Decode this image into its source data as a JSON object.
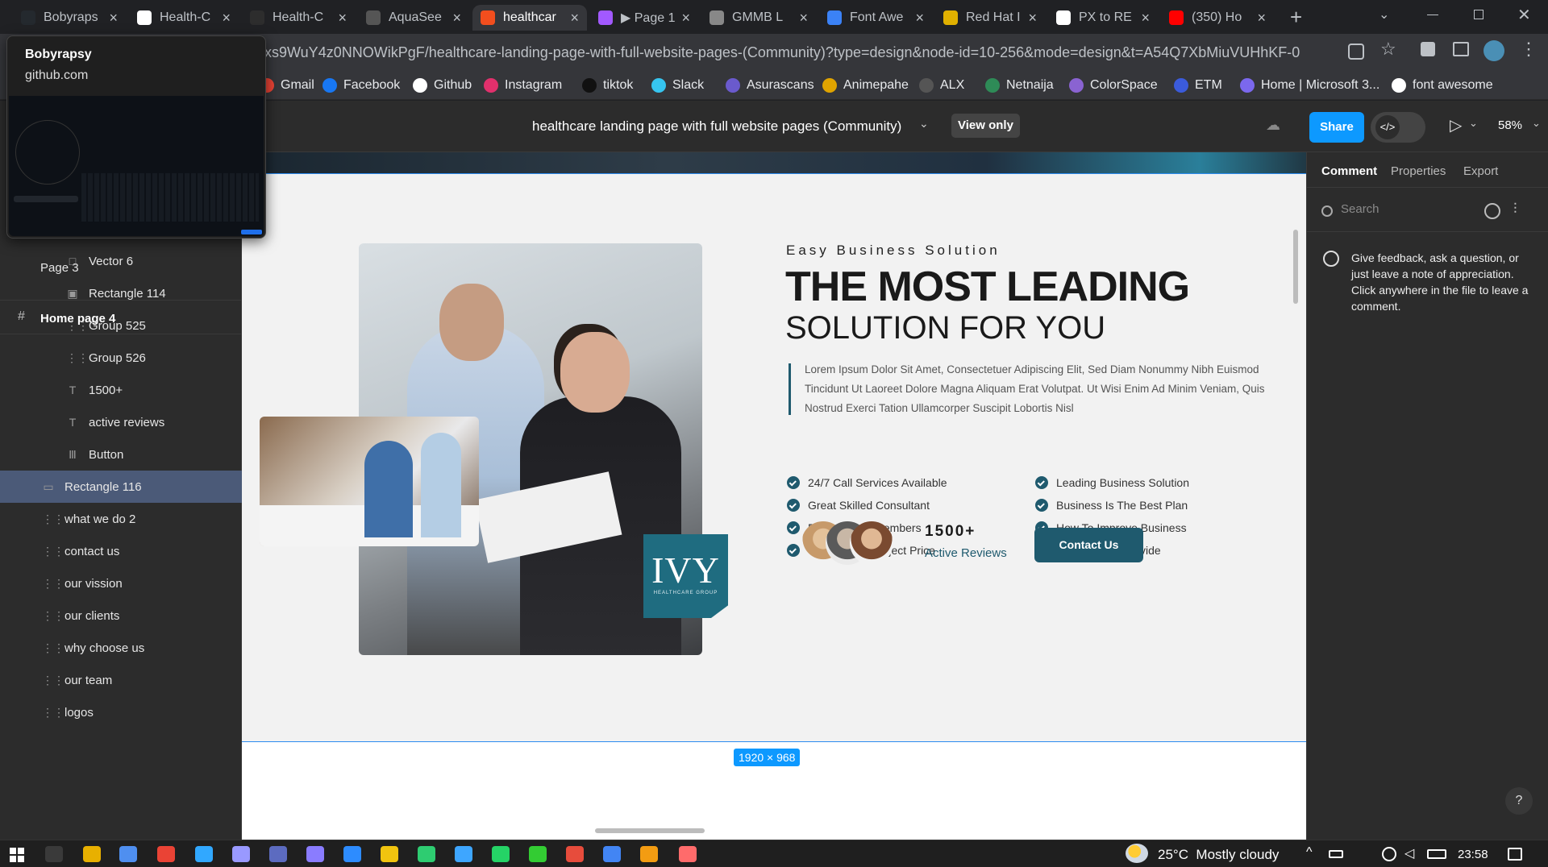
{
  "browser": {
    "tabs": [
      {
        "title": "Bobyraps",
        "color": "#24292e"
      },
      {
        "title": "Health-C",
        "color": "#ffffff"
      },
      {
        "title": "Health-C",
        "color": "#2d2d2d"
      },
      {
        "title": "AquaSee",
        "color": "#555"
      },
      {
        "title": "healthcar",
        "color": "#f24e1e",
        "active": true
      },
      {
        "title": "▶ Page 1",
        "color": "#a259ff"
      },
      {
        "title": "GMMB L",
        "color": "#888"
      },
      {
        "title": "Font Awe",
        "color": "#3b82f6"
      },
      {
        "title": "Red Hat I",
        "color": "#e0b000"
      },
      {
        "title": "PX to RE",
        "color": "#ffffff"
      },
      {
        "title": "(350) Ho",
        "color": "#ff0000"
      }
    ],
    "url": "xs9WuY4z0NNOWikPgF/healthcare-landing-page-with-full-website-pages-(Community)?type=design&node-id=10-256&mode=design&t=A54Q7XbMiuVUHhKF-0",
    "bookmarks": [
      {
        "label": "Gmail",
        "color": "#ea4335"
      },
      {
        "label": "Facebook",
        "color": "#1877f2"
      },
      {
        "label": "Github",
        "color": "#ffffff"
      },
      {
        "label": "Instagram",
        "color": "#e1306c"
      },
      {
        "label": "tiktok",
        "color": "#111"
      },
      {
        "label": "Slack",
        "color": "#36c5f0"
      },
      {
        "label": "Asurascans",
        "color": "#6a5acd"
      },
      {
        "label": "Animepahe",
        "color": "#e0a400"
      },
      {
        "label": "ALX",
        "color": "#555"
      },
      {
        "label": "Netnaija",
        "color": "#2e8b57"
      },
      {
        "label": "ColorSpace",
        "color": "#8a63d2"
      },
      {
        "label": "ETM",
        "color": "#3b5bdb"
      },
      {
        "label": "Home | Microsoft 3...",
        "color": "#7b68ee"
      },
      {
        "label": "font awesome",
        "color": "#ffffff"
      }
    ],
    "profile_popup": {
      "name": "Bobyrapsy",
      "domain": "github.com"
    }
  },
  "figma": {
    "file_title": "healthcare landing page with full website pages (Community)",
    "view_only": "View only",
    "share": "Share",
    "zoom": "58%",
    "pages": [
      "Page 3"
    ],
    "frame": "Home page 4",
    "layers": [
      {
        "name": "Vector 6",
        "icon": "□"
      },
      {
        "name": "Rectangle 114",
        "icon": "▣"
      },
      {
        "name": "Group 525",
        "icon": "⋮⋮"
      },
      {
        "name": "Group 526",
        "icon": "⋮⋮"
      },
      {
        "name": "1500+",
        "icon": "T"
      },
      {
        "name": "active reviews",
        "icon": "T"
      },
      {
        "name": "Button",
        "icon": "Ⅲ"
      },
      {
        "name": "Rectangle 116",
        "icon": "▭",
        "selected": true
      },
      {
        "name": "what we do 2",
        "icon": "⋮⋮"
      },
      {
        "name": "contact us",
        "icon": "⋮⋮"
      },
      {
        "name": "our vission",
        "icon": "⋮⋮"
      },
      {
        "name": "our clients",
        "icon": "⋮⋮"
      },
      {
        "name": "why choose us",
        "icon": "⋮⋮"
      },
      {
        "name": "our team",
        "icon": "⋮⋮"
      },
      {
        "name": "logos",
        "icon": "⋮⋮"
      }
    ],
    "right_tabs": [
      "Comment",
      "Properties",
      "Export"
    ],
    "search_placeholder": "Search",
    "comment_hint": "Give feedback, ask a question, or just leave a note of appreciation. Click anywhere in the file to leave a comment.",
    "frame_size": "1920 × 968",
    "help": "?"
  },
  "design": {
    "eyebrow": "Easy Business Solution",
    "headline1": "THE MOST LEADING",
    "headline2": "SOLUTION FOR YOU",
    "paragraph": "Lorem Ipsum Dolor Sit Amet, Consectetuer Adipiscing Elit, Sed Diam Nonummy Nibh Euismod Tincidunt Ut Laoreet Dolore Magna Aliquam Erat Volutpat. Ut Wisi Enim Ad Minim Veniam, Quis Nostrud Exerci Tation Ullamcorper Suscipit Lobortis Nisl",
    "features_left": [
      "24/7 Call Services Available",
      "Great Skilled Consultant",
      "Expert Team Members",
      "Reasonable Project Price"
    ],
    "features_right": [
      "Leading Business Solution",
      "Business Is The Best Plan",
      "How To Improve Business",
      "Services We Provide"
    ],
    "reviews_count": "1500+",
    "reviews_label": "Active Reviews",
    "cta": "Contact Us",
    "logo_main": "IVY",
    "logo_sub": "HEALTHCARE GROUP",
    "accent": "#1f5a6e"
  },
  "taskbar": {
    "weather": "25°C  Mostly cloudy",
    "time": "23:58"
  }
}
